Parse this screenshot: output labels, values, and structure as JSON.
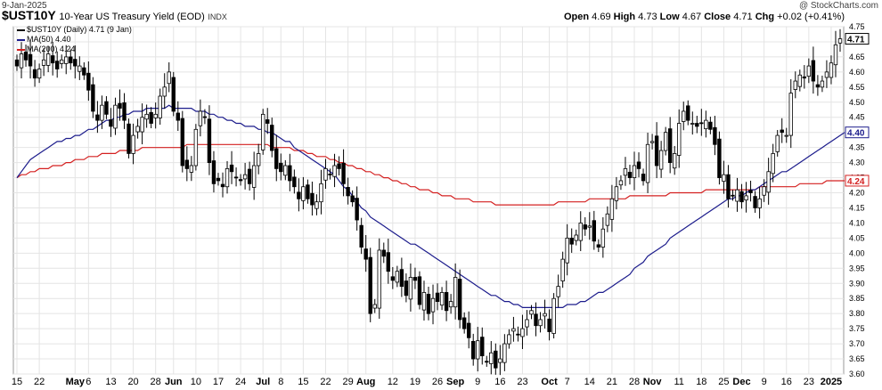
{
  "header": {
    "date": "9-Jan-2025",
    "symbol": "$UST10Y",
    "description": "10-Year US Treasury Yield (EOD)",
    "exchange": "INDX",
    "watermark": "@ StockCharts.com",
    "open_label": "Open",
    "open": "4.69",
    "high_label": "High",
    "high": "4.73",
    "low_label": "Low",
    "low": "4.67",
    "close_label": "Close",
    "close": "4.71",
    "chg_label": "Chg",
    "chg": "+0.02 (+0.41%)"
  },
  "legend": [
    {
      "text": "$UST10Y (Daily) 4.71 (9 Jan)",
      "color": "#000000"
    },
    {
      "text": "MA(50) 4.40",
      "color": "#1c1c8c"
    },
    {
      "text": "MA(200) 4.24",
      "color": "#d42020"
    }
  ],
  "chart_data": {
    "type": "candlestick",
    "y_axis": {
      "min": 3.6,
      "max": 4.75,
      "ticks": [
        "3.60",
        "3.65",
        "3.70",
        "3.75",
        "3.80",
        "3.85",
        "3.90",
        "3.95",
        "4.00",
        "4.05",
        "4.10",
        "4.15",
        "4.20",
        "4.25",
        "4.30",
        "4.35",
        "4.40",
        "4.45",
        "4.50",
        "4.55",
        "4.60",
        "4.65",
        "4.70",
        "4.75"
      ]
    },
    "x_axis": {
      "ticks": [
        {
          "label": "15",
          "i": 0
        },
        {
          "label": "22",
          "i": 5
        },
        {
          "label": "May",
          "i": 13,
          "bold": true
        },
        {
          "label": "6",
          "i": 16
        },
        {
          "label": "13",
          "i": 21
        },
        {
          "label": "20",
          "i": 26
        },
        {
          "label": "28",
          "i": 31
        },
        {
          "label": "Jun",
          "i": 35,
          "bold": true
        },
        {
          "label": "10",
          "i": 40
        },
        {
          "label": "17",
          "i": 45
        },
        {
          "label": "24",
          "i": 50
        },
        {
          "label": "Jul",
          "i": 55,
          "bold": true
        },
        {
          "label": "8",
          "i": 59
        },
        {
          "label": "15",
          "i": 64
        },
        {
          "label": "22",
          "i": 69
        },
        {
          "label": "29",
          "i": 74
        },
        {
          "label": "Aug",
          "i": 78,
          "bold": true
        },
        {
          "label": "12",
          "i": 84
        },
        {
          "label": "19",
          "i": 89
        },
        {
          "label": "26",
          "i": 94
        },
        {
          "label": "Sep",
          "i": 98,
          "bold": true
        },
        {
          "label": "9",
          "i": 103
        },
        {
          "label": "16",
          "i": 108
        },
        {
          "label": "23",
          "i": 113
        },
        {
          "label": "Oct",
          "i": 119,
          "bold": true
        },
        {
          "label": "7",
          "i": 123
        },
        {
          "label": "14",
          "i": 128
        },
        {
          "label": "21",
          "i": 133
        },
        {
          "label": "28",
          "i": 138
        },
        {
          "label": "Nov",
          "i": 142,
          "bold": true
        },
        {
          "label": "11",
          "i": 148
        },
        {
          "label": "18",
          "i": 153
        },
        {
          "label": "25",
          "i": 158
        },
        {
          "label": "Dec",
          "i": 162,
          "bold": true
        },
        {
          "label": "9",
          "i": 167
        },
        {
          "label": "16",
          "i": 172
        },
        {
          "label": "23",
          "i": 177
        },
        {
          "label": "2025",
          "i": 182,
          "bold": true
        }
      ]
    },
    "last_labels": [
      {
        "text": "4.71",
        "value": 4.71,
        "color": "#000000"
      },
      {
        "text": "4.40",
        "value": 4.4,
        "color": "#1c1c8c"
      },
      {
        "text": "4.24",
        "value": 4.24,
        "color": "#d42020"
      }
    ],
    "closes": [
      4.62,
      4.66,
      4.64,
      4.62,
      4.58,
      4.61,
      4.64,
      4.66,
      4.63,
      4.61,
      4.64,
      4.65,
      4.63,
      4.62,
      4.62,
      4.59,
      4.54,
      4.47,
      4.44,
      4.49,
      4.46,
      4.42,
      4.49,
      4.48,
      4.44,
      4.33,
      4.39,
      4.42,
      4.45,
      4.46,
      4.43,
      4.46,
      4.52,
      4.55,
      4.6,
      4.47,
      4.44,
      4.29,
      4.28,
      4.29,
      4.41,
      4.47,
      4.45,
      4.3,
      4.23,
      4.24,
      4.22,
      4.28,
      4.27,
      4.25,
      4.24,
      4.26,
      4.23,
      4.29,
      4.33,
      4.46,
      4.43,
      4.34,
      4.28,
      4.27,
      4.29,
      4.24,
      4.22,
      4.18,
      4.22,
      4.18,
      4.16,
      4.17,
      4.23,
      4.28,
      4.26,
      4.29,
      4.28,
      4.23,
      4.19,
      4.17,
      4.11,
      4.02,
      3.98,
      3.8,
      3.83,
      4.01,
      3.99,
      3.94,
      3.91,
      3.94,
      3.89,
      3.86,
      3.92,
      3.91,
      3.83,
      3.87,
      3.8,
      3.85,
      3.84,
      3.87,
      3.81,
      3.84,
      3.92,
      3.78,
      3.75,
      3.72,
      3.65,
      3.71,
      3.66,
      3.64,
      3.67,
      3.62,
      3.65,
      3.7,
      3.73,
      3.75,
      3.73,
      3.75,
      3.78,
      3.81,
      3.76,
      3.78,
      3.8,
      3.74,
      3.85,
      3.89,
      3.98,
      4.05,
      4.03,
      4.06,
      4.1,
      4.08,
      4.09,
      4.04,
      4.02,
      4.08,
      4.13,
      4.18,
      4.22,
      4.24,
      4.28,
      4.25,
      4.29,
      4.28,
      4.24,
      4.36,
      4.37,
      4.29,
      4.34,
      4.4,
      4.3,
      4.33,
      4.43,
      4.47,
      4.44,
      4.43,
      4.42,
      4.43,
      4.44,
      4.41,
      4.36,
      4.25,
      4.26,
      4.18,
      4.19,
      4.21,
      4.17,
      4.19,
      4.2,
      4.15,
      4.18,
      4.22,
      4.27,
      4.33,
      4.39,
      4.4,
      4.39,
      4.53,
      4.57,
      4.59,
      4.58,
      4.62,
      4.57,
      4.55,
      4.57,
      4.6,
      4.63,
      4.69,
      4.71
    ],
    "ma50": [
      4.25,
      4.27,
      4.29,
      4.31,
      4.32,
      4.33,
      4.34,
      4.35,
      4.36,
      4.37,
      4.37,
      4.38,
      4.38,
      4.39,
      4.39,
      4.4,
      4.41,
      4.41,
      4.42,
      4.43,
      4.44,
      4.44,
      4.45,
      4.45,
      4.46,
      4.46,
      4.47,
      4.47,
      4.47,
      4.48,
      4.48,
      4.48,
      4.48,
      4.48,
      4.49,
      4.48,
      4.48,
      4.48,
      4.48,
      4.48,
      4.47,
      4.47,
      4.47,
      4.46,
      4.46,
      4.45,
      4.45,
      4.44,
      4.44,
      4.43,
      4.43,
      4.42,
      4.42,
      4.42,
      4.41,
      4.41,
      4.4,
      4.4,
      4.39,
      4.38,
      4.37,
      4.37,
      4.35,
      4.34,
      4.33,
      4.32,
      4.31,
      4.3,
      4.29,
      4.28,
      4.27,
      4.26,
      4.24,
      4.22,
      4.21,
      4.19,
      4.17,
      4.15,
      4.14,
      4.12,
      4.11,
      4.1,
      4.09,
      4.08,
      4.07,
      4.06,
      4.05,
      4.04,
      4.03,
      4.03,
      4.02,
      4.01,
      4.0,
      3.99,
      3.98,
      3.97,
      3.96,
      3.95,
      3.94,
      3.93,
      3.92,
      3.91,
      3.9,
      3.89,
      3.88,
      3.87,
      3.86,
      3.86,
      3.85,
      3.84,
      3.84,
      3.83,
      3.83,
      3.82,
      3.82,
      3.82,
      3.82,
      3.82,
      3.82,
      3.82,
      3.82,
      3.82,
      3.82,
      3.83,
      3.83,
      3.83,
      3.84,
      3.84,
      3.85,
      3.86,
      3.87,
      3.87,
      3.88,
      3.89,
      3.9,
      3.91,
      3.92,
      3.93,
      3.95,
      3.96,
      3.97,
      3.99,
      4.0,
      4.01,
      4.02,
      4.03,
      4.05,
      4.06,
      4.07,
      4.08,
      4.09,
      4.1,
      4.11,
      4.12,
      4.13,
      4.14,
      4.15,
      4.16,
      4.17,
      4.18,
      4.18,
      4.19,
      4.19,
      4.2,
      4.21,
      4.21,
      4.22,
      4.23,
      4.24,
      4.25,
      4.26,
      4.27,
      4.27,
      4.28,
      4.29,
      4.3,
      4.31,
      4.32,
      4.33,
      4.34,
      4.35,
      4.36,
      4.37,
      4.38,
      4.39,
      4.4
    ],
    "ma200": [
      4.25,
      4.26,
      4.26,
      4.27,
      4.27,
      4.28,
      4.28,
      4.28,
      4.29,
      4.29,
      4.29,
      4.3,
      4.3,
      4.31,
      4.31,
      4.31,
      4.32,
      4.32,
      4.32,
      4.33,
      4.33,
      4.33,
      4.33,
      4.34,
      4.34,
      4.34,
      4.34,
      4.34,
      4.35,
      4.35,
      4.35,
      4.35,
      4.35,
      4.35,
      4.35,
      4.35,
      4.35,
      4.35,
      4.36,
      4.36,
      4.36,
      4.36,
      4.36,
      4.36,
      4.36,
      4.36,
      4.36,
      4.36,
      4.36,
      4.36,
      4.36,
      4.36,
      4.36,
      4.36,
      4.36,
      4.36,
      4.36,
      4.35,
      4.35,
      4.35,
      4.35,
      4.35,
      4.34,
      4.34,
      4.34,
      4.33,
      4.33,
      4.32,
      4.32,
      4.32,
      4.31,
      4.31,
      4.3,
      4.3,
      4.29,
      4.29,
      4.28,
      4.28,
      4.27,
      4.27,
      4.26,
      4.26,
      4.25,
      4.25,
      4.24,
      4.24,
      4.23,
      4.23,
      4.22,
      4.22,
      4.21,
      4.21,
      4.21,
      4.2,
      4.2,
      4.19,
      4.19,
      4.19,
      4.18,
      4.18,
      4.18,
      4.18,
      4.17,
      4.17,
      4.17,
      4.17,
      4.17,
      4.16,
      4.16,
      4.16,
      4.16,
      4.16,
      4.16,
      4.16,
      4.16,
      4.16,
      4.16,
      4.16,
      4.16,
      4.16,
      4.16,
      4.17,
      4.17,
      4.17,
      4.17,
      4.17,
      4.17,
      4.17,
      4.18,
      4.18,
      4.18,
      4.18,
      4.18,
      4.18,
      4.18,
      4.18,
      4.18,
      4.19,
      4.19,
      4.19,
      4.19,
      4.19,
      4.19,
      4.19,
      4.19,
      4.19,
      4.2,
      4.2,
      4.2,
      4.2,
      4.2,
      4.2,
      4.2,
      4.2,
      4.21,
      4.21,
      4.21,
      4.21,
      4.21,
      4.21,
      4.21,
      4.21,
      4.21,
      4.21,
      4.21,
      4.21,
      4.22,
      4.22,
      4.22,
      4.22,
      4.22,
      4.22,
      4.22,
      4.22,
      4.22,
      4.23,
      4.23,
      4.23,
      4.23,
      4.23,
      4.23,
      4.24,
      4.24,
      4.24,
      4.24,
      4.24
    ]
  }
}
